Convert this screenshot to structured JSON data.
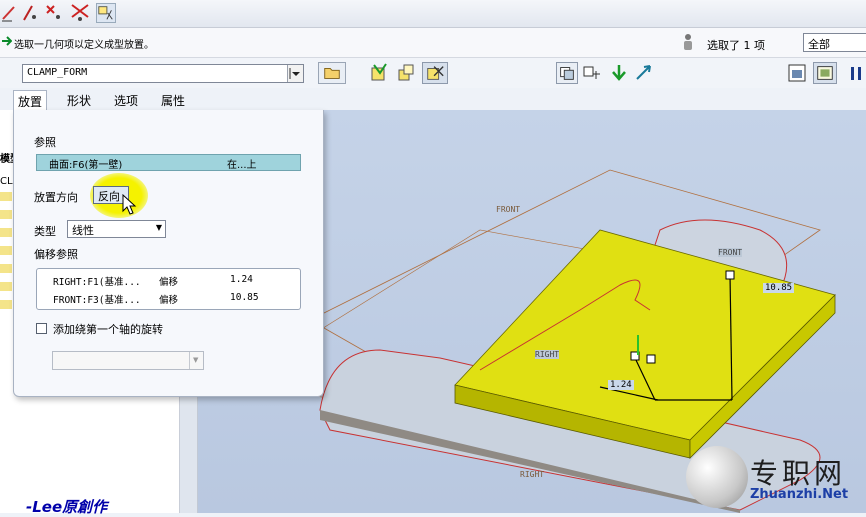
{
  "message": {
    "prompt": "选取一几何项以定义成型放置。",
    "selection_count": "选取了 1 项",
    "filter": "全部"
  },
  "dashboard": {
    "part_name": "CLAMP_FORM"
  },
  "tabs": [
    {
      "label": "放置"
    },
    {
      "label": "形状"
    },
    {
      "label": "选项"
    },
    {
      "label": "属性"
    }
  ],
  "panel": {
    "reference_heading": "参照",
    "reference_item": "曲面:F6(第一壁)",
    "reference_relation": "在...上",
    "orientation_label": "放置方向",
    "flip_button": "反向",
    "type_label": "类型",
    "type_value": "线性",
    "offset_heading": "偏移参照",
    "offsets": [
      {
        "ref": "RIGHT:F1(基准...",
        "kind": "偏移",
        "value": "1.24"
      },
      {
        "ref": "FRONT:F3(基准...",
        "kind": "偏移",
        "value": "10.85"
      }
    ],
    "rotation_checkbox": "添加绕第一个轴的旋转"
  },
  "viewport": {
    "plane_labels": [
      "FRONT",
      "FRONT",
      "RIGHT",
      "RIGHT"
    ],
    "dim_a": "10.85",
    "dim_b": "1.24"
  },
  "tree_fragments": [
    "模型",
    "CL"
  ],
  "watermark": {
    "cn": "专职网",
    "en": "Zhuanzhi.Net",
    "credit": "-Lee原創作"
  },
  "colors": {
    "accent_yellow": "#e6e61a",
    "ref_highlight": "#9fd3dc",
    "viewport_bg": "#c2d0e6"
  }
}
